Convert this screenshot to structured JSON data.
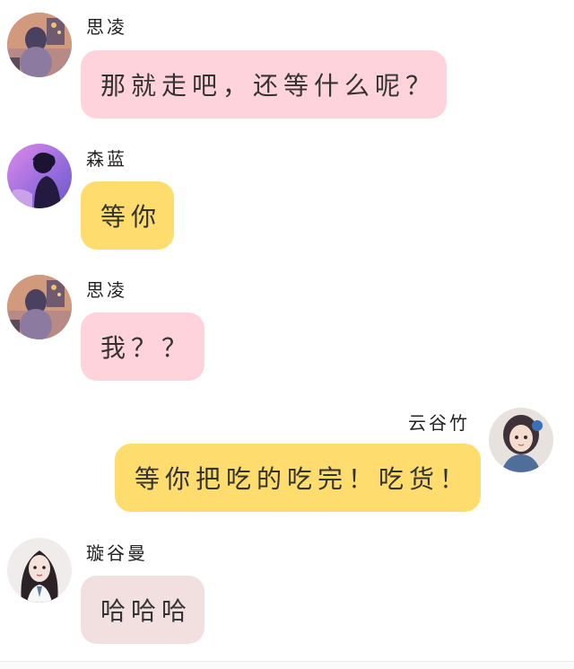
{
  "messages": [
    {
      "sender": "思凌",
      "text": "那就走吧，还等什么呢？",
      "avatar": "girl-room-avatar",
      "side": "left",
      "bubble": "#ffd3dc"
    },
    {
      "sender": "森蓝",
      "text": "等你",
      "avatar": "purple-silhouette-avatar",
      "side": "left",
      "bubble": "#ffdc6e"
    },
    {
      "sender": "思凌",
      "text": "我？？",
      "avatar": "girl-room-avatar",
      "side": "left",
      "bubble": "#ffd3dc"
    },
    {
      "sender": "云谷竹",
      "text": "等你把吃的吃完！吃货！",
      "avatar": "anime-girl-avatar",
      "side": "right",
      "bubble": "#ffdc6e"
    },
    {
      "sender": "璇谷曼",
      "text": "哈哈哈",
      "avatar": "long-hair-girl-avatar",
      "side": "left",
      "bubble": "#f2dfe0"
    }
  ]
}
